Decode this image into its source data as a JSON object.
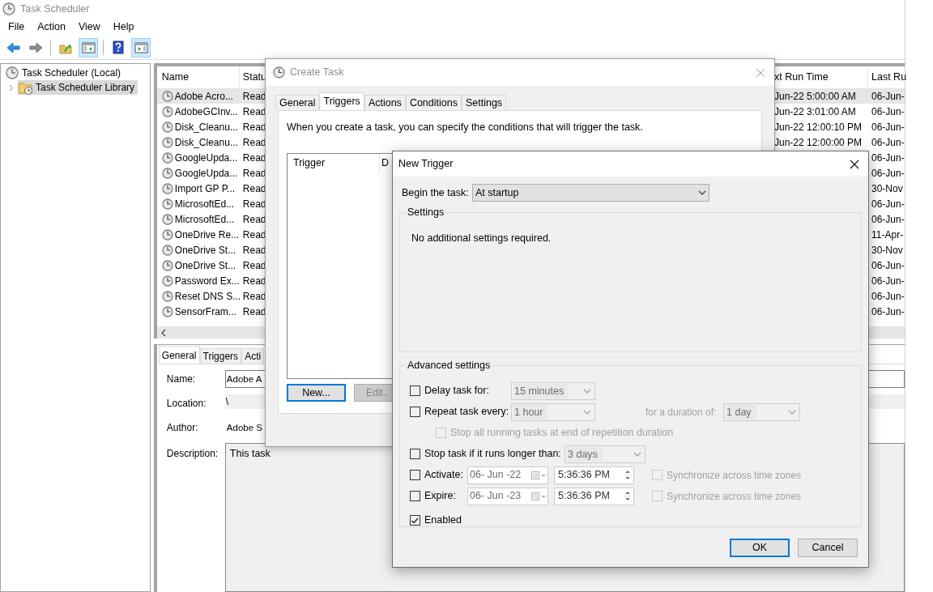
{
  "window": {
    "title": "Task Scheduler"
  },
  "menu": [
    {
      "label": "File"
    },
    {
      "label": "Action"
    },
    {
      "label": "View"
    },
    {
      "label": "Help"
    }
  ],
  "toolbar": [
    {
      "kind": "back",
      "pressed": false
    },
    {
      "kind": "forward",
      "pressed": false
    },
    {
      "kind": "separator"
    },
    {
      "kind": "up-folder",
      "pressed": false
    },
    {
      "kind": "console-tree",
      "pressed": true
    },
    {
      "kind": "separator"
    },
    {
      "kind": "help",
      "pressed": false
    },
    {
      "kind": "action-pane",
      "pressed": true
    }
  ],
  "tree": [
    {
      "label": "Task Scheduler (Local)",
      "selected": false,
      "children": [
        {
          "label": "Task Scheduler Library",
          "selected": true,
          "expanded": false
        }
      ]
    }
  ],
  "task_list": {
    "columns": [
      {
        "label": "Name"
      },
      {
        "label": "Statu"
      },
      {
        "label": "xt Run Time"
      },
      {
        "label": "Last Ru"
      }
    ],
    "rows": [
      {
        "name": "Adobe Acro...",
        "status": "Read",
        "next_run": "Jun-22 5:00:00 AM",
        "last_run": "06-Jun-",
        "selected": true
      },
      {
        "name": "AdobeGCInv...",
        "status": "Read",
        "next_run": "Jun-22 3:01:00 AM",
        "last_run": "06-Jun-",
        "selected": false
      },
      {
        "name": "Disk_Cleanu...",
        "status": "Read",
        "next_run": "Jun-22 12:00:10 PM",
        "last_run": "06-Jun-",
        "selected": false
      },
      {
        "name": "Disk_Cleanu...",
        "status": "Read",
        "next_run": "Jun-22 12:00:00 PM",
        "last_run": "06-Jun-",
        "selected": false
      },
      {
        "name": "GoogleUpda...",
        "status": "Read",
        "last_run": "06-Jun-",
        "selected": false
      },
      {
        "name": "GoogleUpda...",
        "status": "Read",
        "last_run": "06-Jun-",
        "selected": false
      },
      {
        "name": "Import GP P...",
        "status": "Read",
        "last_run": "30-Nov",
        "selected": false
      },
      {
        "name": "MicrosoftEd...",
        "status": "Read",
        "last_run": "06-Jun-",
        "selected": false
      },
      {
        "name": "MicrosoftEd...",
        "status": "Read",
        "last_run": "06-Jun-",
        "selected": false
      },
      {
        "name": "OneDrive Re...",
        "status": "Read",
        "last_run": "11-Apr-",
        "selected": false
      },
      {
        "name": "OneDrive St...",
        "status": "Read",
        "last_run": "30-Nov",
        "selected": false
      },
      {
        "name": "OneDrive St...",
        "status": "Read",
        "last_run": "06-Jun-",
        "selected": false
      },
      {
        "name": "Password Ex...",
        "status": "Read",
        "last_run": "06-Jun-",
        "selected": false
      },
      {
        "name": "Reset DNS S...",
        "status": "Read",
        "last_run": "06-Jun-",
        "selected": false
      },
      {
        "name": "SensorFram...",
        "status": "Read",
        "last_run": "06-Jun-",
        "selected": false
      }
    ]
  },
  "details": {
    "tabs": [
      {
        "label": "General",
        "selected": true
      },
      {
        "label": "Triggers",
        "selected": false
      },
      {
        "label": "Acti",
        "selected": false
      }
    ],
    "fields": [
      {
        "kind": "input",
        "label": "Name:",
        "value": "Adobe A"
      },
      {
        "kind": "readonly",
        "label": "Location:",
        "value": "\\"
      },
      {
        "kind": "text",
        "label": "Author:",
        "value": "Adobe S"
      },
      {
        "kind": "textarea",
        "label": "Description:",
        "value": "This task"
      }
    ]
  },
  "create_task": {
    "title": "Create Task",
    "tabs": [
      {
        "label": "General",
        "selected": false
      },
      {
        "label": "Triggers",
        "selected": true
      },
      {
        "label": "Actions",
        "selected": false
      },
      {
        "label": "Conditions",
        "selected": false
      },
      {
        "label": "Settings",
        "selected": false
      }
    ],
    "intro": "When you create a task, you can specify the conditions that will trigger the task.",
    "trigger_columns": [
      {
        "label": "Trigger"
      },
      {
        "label": "D"
      }
    ],
    "buttons": [
      {
        "label": "New...",
        "default": true,
        "disabled": false
      },
      {
        "label": "Edit..",
        "default": false,
        "disabled": true
      }
    ]
  },
  "new_trigger": {
    "title": "New Trigger",
    "begin_label": "Begin the task:",
    "begin_value": "At startup",
    "settings": {
      "title": "Settings",
      "message": "No additional settings required."
    },
    "advanced_title": "Advanced settings",
    "advanced": [
      {
        "kind": "select",
        "label": "Delay task for:",
        "checked": false,
        "disabled": false,
        "value": "15 minutes"
      },
      {
        "kind": "repeat",
        "label": "Repeat task every:",
        "checked": false,
        "disabled": false,
        "value": "1 hour",
        "duration_label": "for a duration of:",
        "duration_value": "1 day"
      },
      {
        "kind": "sub-check",
        "label": "Stop all running tasks at end of repetition duration",
        "checked": false,
        "disabled": true
      },
      {
        "kind": "select",
        "label": "Stop task if it runs longer than:",
        "checked": false,
        "disabled": false,
        "value": "3 days"
      },
      {
        "kind": "datetime",
        "label": "Activate:",
        "checked": false,
        "disabled": false,
        "date": "06- Jun -22",
        "time": "5:36:36 PM",
        "sync_label": "Synchronize across time zones",
        "sync_checked": false
      },
      {
        "kind": "datetime",
        "label": "Expire:",
        "checked": false,
        "disabled": false,
        "date": "06- Jun -23",
        "time": "5:36:36 PM",
        "sync_label": "Synchronize across time zones",
        "sync_checked": false
      },
      {
        "kind": "check",
        "label": "Enabled",
        "checked": true,
        "disabled": false
      }
    ],
    "buttons": [
      {
        "label": "OK",
        "default": true
      },
      {
        "label": "Cancel",
        "default": false
      }
    ]
  }
}
